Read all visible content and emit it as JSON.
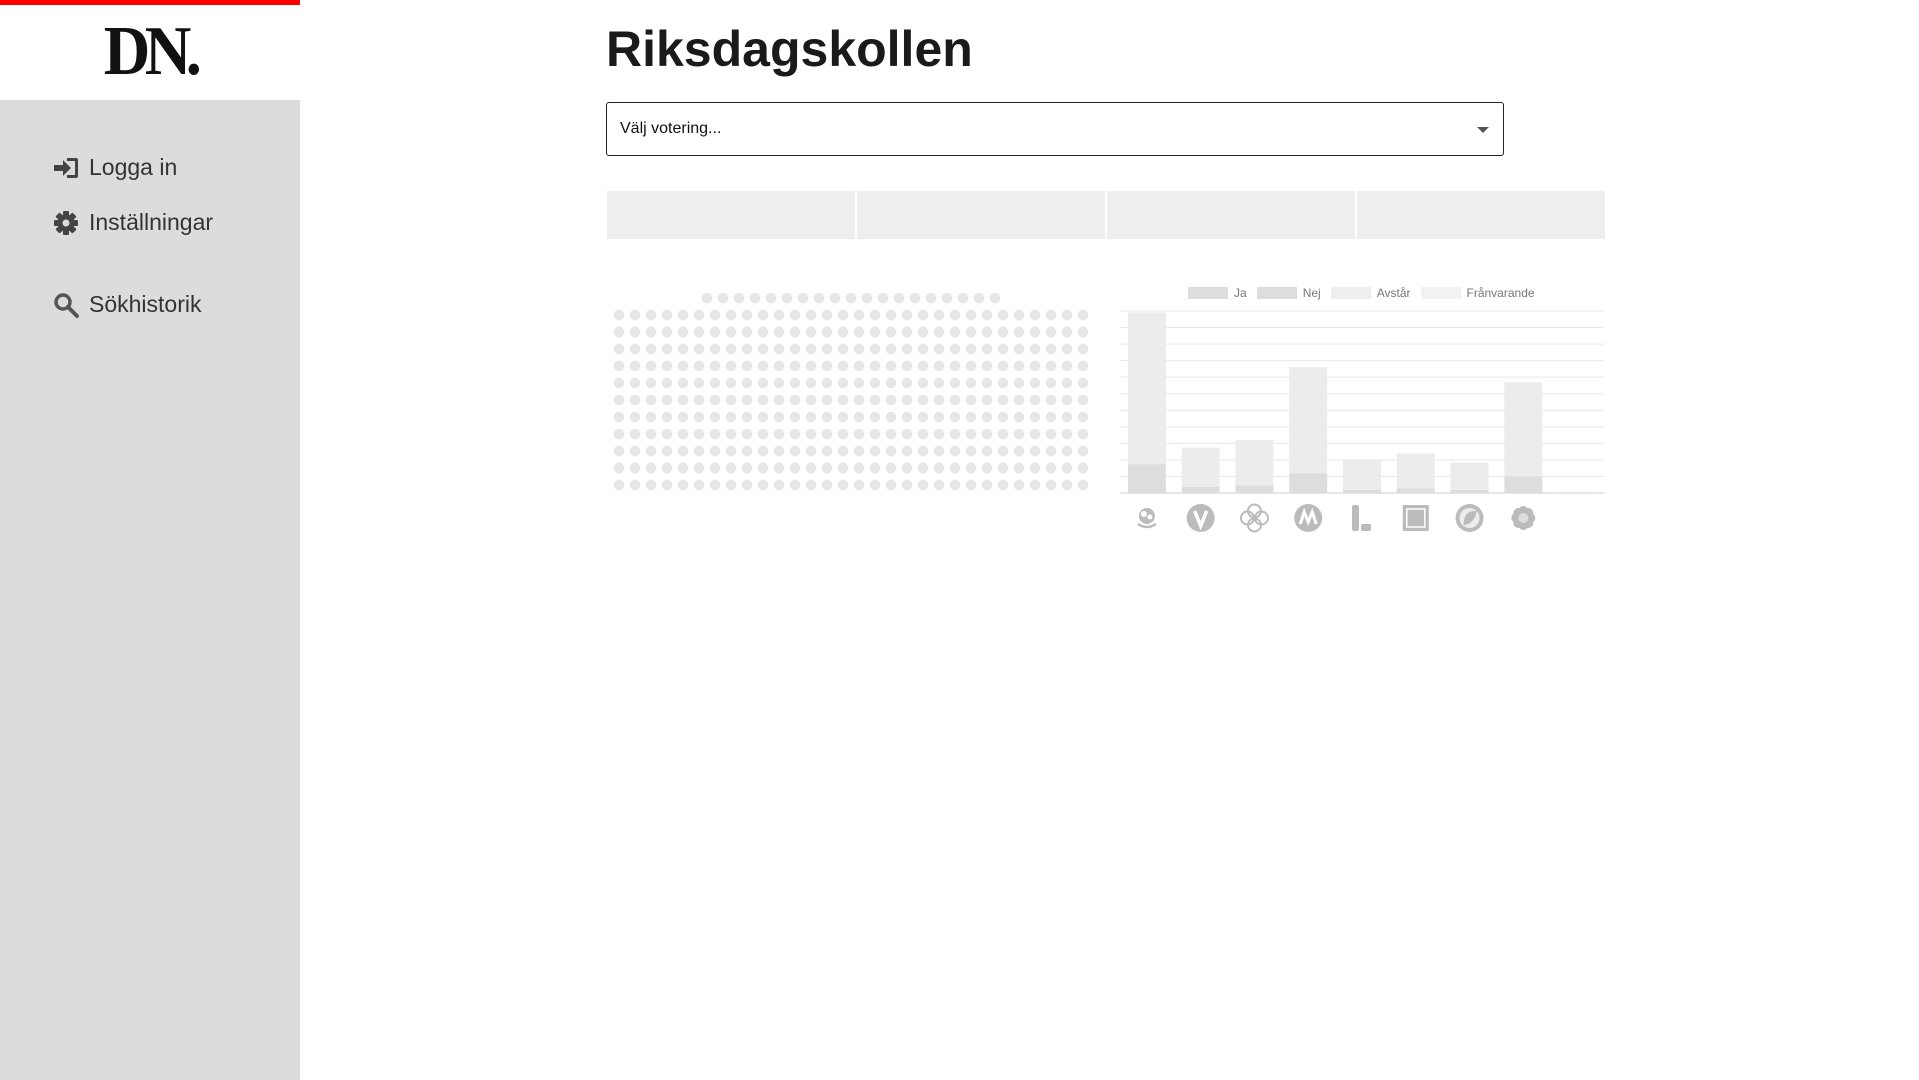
{
  "brand": {
    "logo_text": "DN.",
    "accent_color": "#ff0000"
  },
  "sidebar": {
    "items": [
      {
        "label": "Logga in",
        "icon": "sign-in-icon"
      },
      {
        "label": "Inställningar",
        "icon": "gear-icon"
      },
      {
        "label": "Sökhistorik",
        "icon": "search-icon"
      }
    ]
  },
  "main": {
    "title": "Riksdagskollen",
    "vote_select": {
      "value": "Välj votering..."
    },
    "tabs": [
      "",
      "",
      "",
      ""
    ]
  },
  "seat_map": {
    "total_seats": 349,
    "color": "#e6e6e6"
  },
  "chart_data": {
    "type": "bar",
    "legend": [
      "Ja",
      "Nej",
      "Avstår",
      "Frånvarande"
    ],
    "legend_colors": [
      "#dddddd",
      "#dddddd",
      "#eeeeee",
      "#f2f2f2"
    ],
    "categories": [
      "S",
      "V",
      "C",
      "M",
      "L",
      "KD",
      "MP",
      "SD",
      "-"
    ],
    "category_icons": [
      "rose-icon",
      "v-letter-icon",
      "clover-icon",
      "m-letter-icon",
      "l-letter-icon",
      "kd-box-icon",
      "leaf-circle-icon",
      "flower-icon",
      ""
    ],
    "series": [
      {
        "name": "Ja",
        "values": [
          100,
          26,
          30,
          70,
          20,
          23,
          18,
          62,
          1
        ],
        "color": "#ececec"
      },
      {
        "name": "Nej",
        "values": [
          19,
          4,
          5,
          13,
          2,
          3,
          2,
          11,
          0
        ],
        "color": "#dddddd"
      }
    ],
    "ylim": [
      0,
      120
    ],
    "grid": true,
    "legend_position": "top"
  }
}
